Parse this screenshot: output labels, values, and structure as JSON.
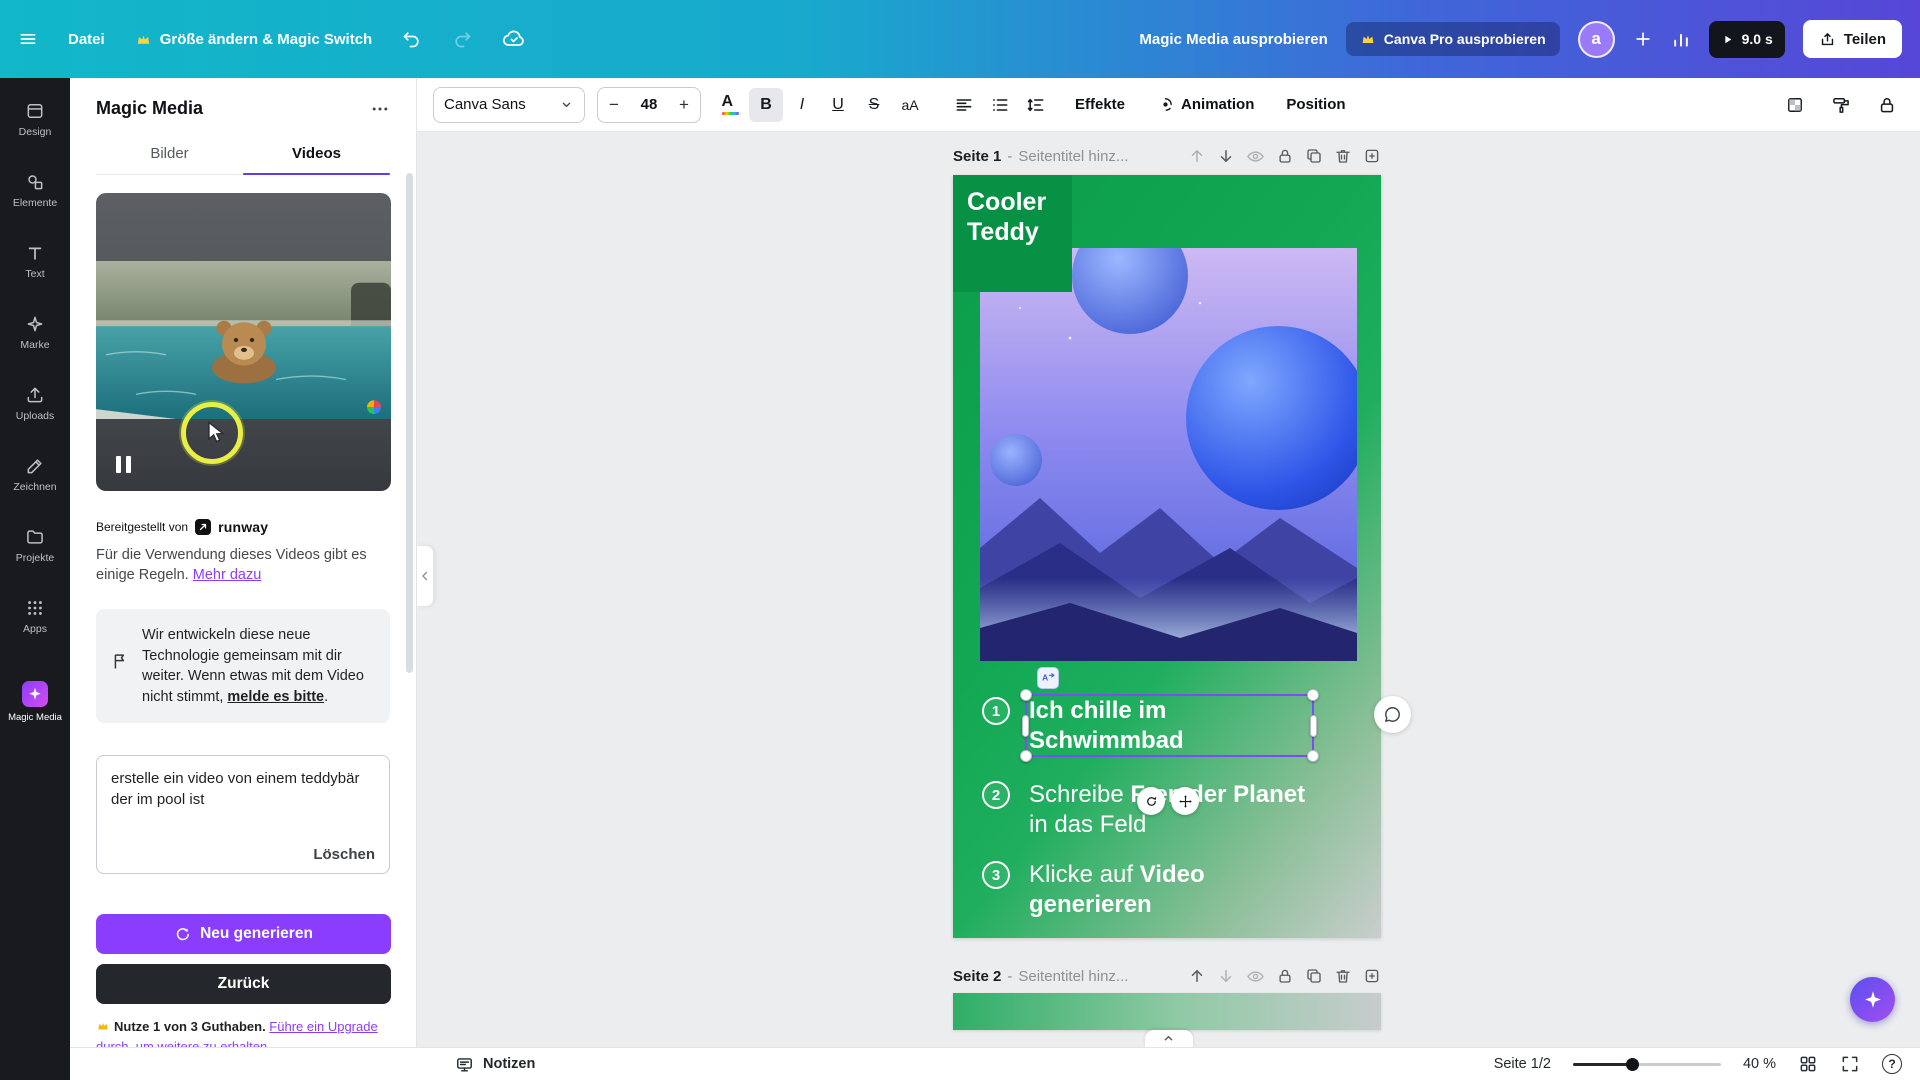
{
  "colors": {
    "brand": "#8b3dff",
    "topbar_start": "#12b7c9",
    "topbar_end": "#5746d8",
    "selection": "#7b4df5",
    "tab_accent": "#5a3df0",
    "highlight_ring": "#e9f043",
    "page_green": "#12a853"
  },
  "topbar": {
    "file": "Datei",
    "resize": "Größe ändern & Magic Switch",
    "try_magic_media": "Magic Media ausprobieren",
    "try_pro": "Canva Pro ausprobieren",
    "avatar": "a",
    "duration": "9.0 s",
    "share": "Teilen"
  },
  "rail": {
    "items": [
      {
        "label": "Design"
      },
      {
        "label": "Elemente"
      },
      {
        "label": "Text"
      },
      {
        "label": "Marke"
      },
      {
        "label": "Uploads"
      },
      {
        "label": "Zeichnen"
      },
      {
        "label": "Projekte"
      },
      {
        "label": "Apps"
      },
      {
        "label": "Magic Media"
      }
    ]
  },
  "toolbar": {
    "font": "Canva Sans",
    "size": "48",
    "minus": "−",
    "plus": "+",
    "bold": "B",
    "italic": "I",
    "underline": "U",
    "strike": "S",
    "case": "aA",
    "color": "A",
    "effects": "Effekte",
    "animation": "Animation",
    "position": "Position"
  },
  "panel": {
    "title": "Magic Media",
    "tabs": {
      "images": "Bilder",
      "videos": "Videos"
    },
    "provided_by": "Bereitgestellt von",
    "provider": "runway",
    "rules": "Für die Verwendung dieses Videos gibt es einige Regeln. ",
    "rules_link": "Mehr dazu",
    "feedback_pre": "Wir entwickeln diese neue Technologie gemeinsam mit dir weiter. Wenn etwas mit dem Video nicht stimmt, ",
    "feedback_link": "melde es bitte",
    "feedback_post": ".",
    "prompt": "erstelle ein video von einem teddybär der im pool ist",
    "clear": "Löschen",
    "regenerate": "Neu generieren",
    "back": "Zurück",
    "credits": "Nutze 1 von 3 Guthaben. ",
    "credits_link": "Führe ein Upgrade durch, um weitere zu erhalten"
  },
  "canvas": {
    "page1": {
      "label": "Seite 1",
      "dash": "-",
      "placeholder": "Seitentitel hinz..."
    },
    "page2": {
      "label": "Seite 2",
      "dash": "-",
      "placeholder": "Seitentitel hinz..."
    },
    "design": {
      "badge": "Cooler\nTeddy",
      "steps": [
        {
          "num": "1",
          "pre": "",
          "bold": "Ich chille im\nSchwimmbad",
          "post": ""
        },
        {
          "num": "2",
          "pre": "Schreibe ",
          "bold": "Fremder Planet",
          "post": "\nin das Feld"
        },
        {
          "num": "3",
          "pre": "Klicke auf ",
          "bold": "Video generieren",
          "post": ""
        }
      ]
    }
  },
  "bottombar": {
    "notes": "Notizen",
    "page_indicator": "Seite 1/2",
    "zoom": "40 %"
  }
}
